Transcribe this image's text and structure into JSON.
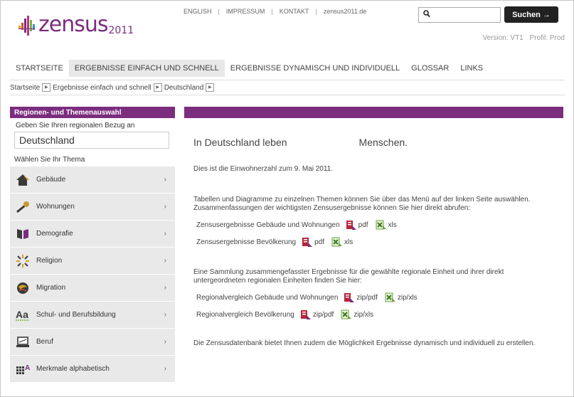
{
  "logo": {
    "text": "zensus",
    "year": "2011"
  },
  "topnav": {
    "items": [
      "ENGLISH",
      "IMPRESSUM",
      "KONTAKT",
      "zensus2011.de"
    ]
  },
  "search": {
    "value": "",
    "button_label": "Suchen →"
  },
  "version": {
    "version": "Version: VT1",
    "profil": "Profil: Prod"
  },
  "mainnav": {
    "items": [
      "STARTSEITE",
      "ERGEBNISSE EINFACH UND SCHNELL",
      "ERGEBNISSE DYNAMISCH UND INDIVIDUELL",
      "GLOSSAR",
      "LINKS"
    ],
    "active_index": 1
  },
  "breadcrumb": {
    "items": [
      "Startseite",
      "Ergebnisse einfach und schnell",
      "Deutschland"
    ]
  },
  "sidebar": {
    "header": "Regionen- und Themenauswahl",
    "region_label": "Geben Sie Ihren regionalen Bezug an",
    "region_value": "Deutschland",
    "theme_label": "Wählen Sie Ihr Thema",
    "themes": [
      {
        "label": "Gebäude",
        "icon": "house-icon"
      },
      {
        "label": "Wohnungen",
        "icon": "key-icon"
      },
      {
        "label": "Demografie",
        "icon": "demography-icon"
      },
      {
        "label": "Religion",
        "icon": "religion-icon"
      },
      {
        "label": "Migration",
        "icon": "migration-icon"
      },
      {
        "label": "Schul- und Berufsbildung",
        "icon": "education-icon"
      },
      {
        "label": "Beruf",
        "icon": "laptop-icon"
      },
      {
        "label": "Merkmale alphabetisch",
        "icon": "alphabet-icon"
      }
    ],
    "chevron": "›"
  },
  "main": {
    "lead_part1": "In Deutschland leben",
    "lead_part2": "Menschen.",
    "date_note": "Dies ist die Einwohnerzahl zum 9. Mai 2011.",
    "intro": "Tabellen und Diagramme zu einzelnen Themen können Sie über das Menü auf der linken Seite auswählen. Zusammenfassungen der wichtigsten Zensusergebnisse können Sie hier direkt abrufen:",
    "summary_downloads": [
      {
        "label": "Zensusergebnisse Gebäude und Wohnungen",
        "pdf": "pdf",
        "xls": "xls"
      },
      {
        "label": "Zensusergebnisse Bevölkerung",
        "pdf": "pdf",
        "xls": "xls"
      }
    ],
    "collection_text": "Eine Sammlung zusammengefasster Ergebnisse für die gewählte regionale Einheit und ihrer direkt untergeordneten regionalen Einheiten finden Sie hier:",
    "regional_downloads": [
      {
        "label": "Regionalvergleich Gebäude und Wohnungen",
        "pdf": "zip/pdf",
        "xls": "zip/xls"
      },
      {
        "label": "Regionalvergleich Bevölkerung",
        "pdf": "zip/pdf",
        "xls": "zip/xls"
      }
    ],
    "db_text": "Die Zensusdatenbank bietet Ihnen zudem die Möglichkeit Ergebnisse dynamisch und individuell zu erstellen."
  },
  "colors": {
    "brand": "#7b2d7e",
    "nav_active": "#e8e8e8",
    "sidebar_bg": "#e9e9e9",
    "button": "#222222"
  }
}
